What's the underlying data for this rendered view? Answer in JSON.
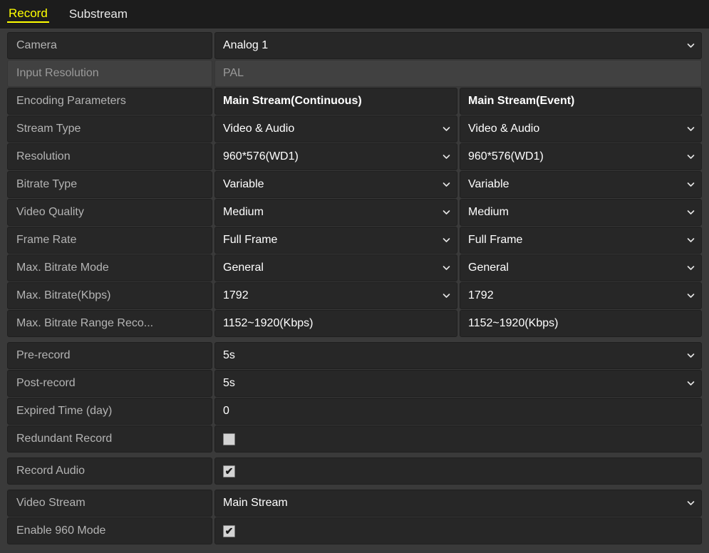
{
  "tabs": [
    {
      "label": "Record",
      "active": true
    },
    {
      "label": "Substream",
      "active": false
    }
  ],
  "columns": {
    "continuous": "Main Stream(Continuous)",
    "event": "Main Stream(Event)"
  },
  "rows": {
    "camera": {
      "label": "Camera",
      "value": "Analog 1"
    },
    "input_resolution": {
      "label": "Input Resolution",
      "value": "PAL"
    },
    "encoding_parameters": {
      "label": "Encoding Parameters"
    },
    "stream_type": {
      "label": "Stream Type",
      "continuous": "Video & Audio",
      "event": "Video & Audio"
    },
    "resolution": {
      "label": "Resolution",
      "continuous": "960*576(WD1)",
      "event": "960*576(WD1)"
    },
    "bitrate_type": {
      "label": "Bitrate Type",
      "continuous": "Variable",
      "event": "Variable"
    },
    "video_quality": {
      "label": "Video Quality",
      "continuous": "Medium",
      "event": "Medium"
    },
    "frame_rate": {
      "label": "Frame Rate",
      "continuous": "Full Frame",
      "event": "Full Frame"
    },
    "max_bitrate_mode": {
      "label": "Max. Bitrate Mode",
      "continuous": "General",
      "event": "General"
    },
    "max_bitrate": {
      "label": "Max. Bitrate(Kbps)",
      "continuous": "1792",
      "event": "1792"
    },
    "max_bitrate_range": {
      "label": "Max. Bitrate Range Reco...",
      "continuous": "1152~1920(Kbps)",
      "event": "1152~1920(Kbps)"
    },
    "pre_record": {
      "label": "Pre-record",
      "value": "5s"
    },
    "post_record": {
      "label": "Post-record",
      "value": "5s"
    },
    "expired_time": {
      "label": "Expired Time (day)",
      "value": "0"
    },
    "redundant_record": {
      "label": "Redundant Record",
      "checked": false
    },
    "record_audio": {
      "label": "Record Audio",
      "checked": true
    },
    "video_stream": {
      "label": "Video Stream",
      "value": "Main Stream"
    },
    "enable_960_mode": {
      "label": "Enable 960 Mode",
      "checked": true
    }
  },
  "icons": {
    "chevron_down": "chevron-down-icon",
    "check": "✔"
  },
  "colors": {
    "page_background": "#3a3a3a",
    "tabbar_background": "#1c1c1c",
    "cell_background": "#272727",
    "disabled_cell_background": "#414141",
    "label_text": "#b4b4b4",
    "value_text": "#ffffff",
    "active_tab": "#ffff00",
    "checkbox_fill": "#d3d3d3"
  }
}
